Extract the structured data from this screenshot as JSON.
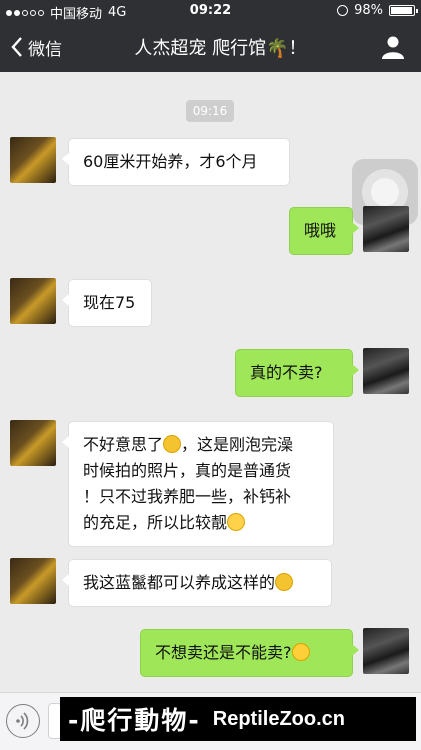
{
  "status_bar": {
    "carrier": "中国移动",
    "network": "4G",
    "time": "09:22",
    "battery": "98%",
    "battery_level": 0.98
  },
  "nav": {
    "back_label": "微信",
    "title": "人杰超宠 爬行馆🌴！",
    "person_icon": "person-icon"
  },
  "chat": {
    "timestamp": "09:16",
    "messages": [
      {
        "side": "in",
        "text": "60厘米开始养，才6个月"
      },
      {
        "side": "out",
        "text": "哦哦"
      },
      {
        "side": "in",
        "text": "现在75"
      },
      {
        "side": "out",
        "text": "真的不卖?"
      },
      {
        "side": "in",
        "line1": "不好意思了",
        "line1b": "，这是刚泡完澡",
        "line2": "时候拍的照片，真的是普通货",
        "line3": "！只不过我养肥一些，补钙补",
        "line4": "的充足，所以比较靓"
      },
      {
        "side": "in",
        "text": "我这蓝鬣都可以养成这样的"
      },
      {
        "side": "out",
        "text": "不想卖还是不能卖?"
      }
    ]
  },
  "input_bar": {
    "voice_icon": "voice-icon"
  },
  "watermark": {
    "cn": "-爬行動物-",
    "en": "ReptileZoo.cn"
  }
}
